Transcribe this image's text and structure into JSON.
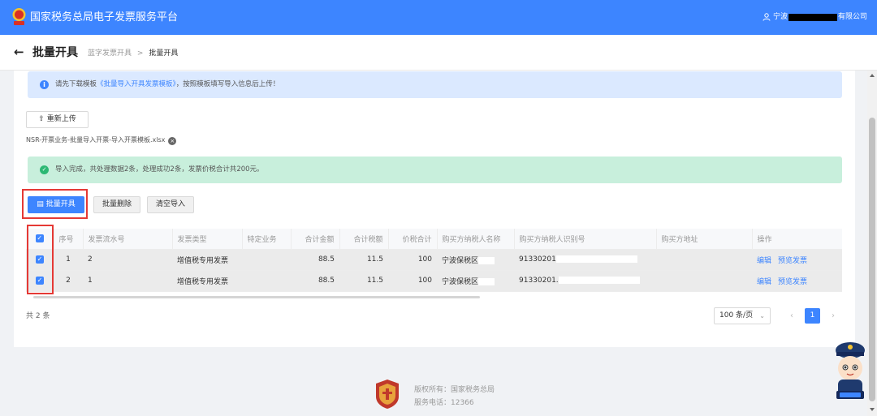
{
  "header": {
    "title": "国家税务总局电子发票服务平台",
    "user_prefix": "宁波",
    "user_suffix": "有限公司"
  },
  "page": {
    "title": "批量开具",
    "breadcrumb": [
      "蓝字发票开具",
      "批量开具"
    ]
  },
  "notice": {
    "pre": "请先下载模板",
    "link": "《批量导入开具发票模板》",
    "post": "，按照模板填写导入信息后上传！"
  },
  "upload": {
    "reupload_label": "重新上传",
    "filename": "NSR-开票业务-批量导入开票-导入开票模板.xlsx"
  },
  "result": {
    "message": "导入完成，共处理数据2条，处理成功2条，发票价税合计共200元。"
  },
  "toolbar": {
    "batch_issue": "批量开具",
    "batch_delete": "批量删除",
    "clear_import": "清空导入"
  },
  "table": {
    "columns": [
      "序号",
      "发票流水号",
      "发票类型",
      "特定业务",
      "合计金额",
      "合计税额",
      "价税合计",
      "购买方纳税人名称",
      "购买方纳税人识别号",
      "购买方地址",
      "操作"
    ],
    "rows": [
      {
        "index": "1",
        "serial": "2",
        "type": "增值税专用发票",
        "special": "",
        "amount": "88.5",
        "tax": "11.5",
        "total": "100",
        "buyer_name": "宁波保税区",
        "buyer_id": "91330201",
        "address": "",
        "edit": "编辑",
        "preview": "预览发票"
      },
      {
        "index": "2",
        "serial": "1",
        "type": "增值税专用发票",
        "special": "",
        "amount": "88.5",
        "tax": "11.5",
        "total": "100",
        "buyer_name": "宁波保税区",
        "buyer_id": "91330201.",
        "address": "",
        "edit": "编辑",
        "preview": "预览发票"
      }
    ]
  },
  "pagination": {
    "total": "共 2 条",
    "page_size": "100 条/页",
    "current": "1"
  },
  "footer": {
    "copyright": "版权所有：国家税务总局",
    "phone": "服务电话：12366"
  },
  "colors": {
    "primary": "#3d85ff",
    "success_bg": "#c8efdc",
    "highlight": "#e53935"
  }
}
